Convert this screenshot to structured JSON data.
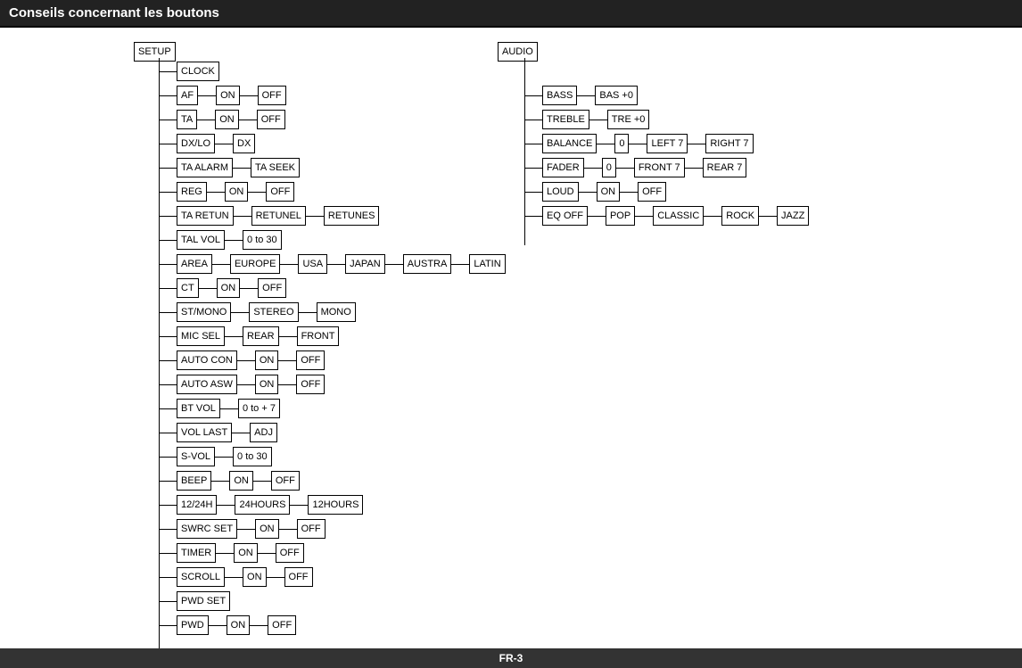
{
  "header": {
    "title": "Conseils concernant les boutons"
  },
  "footer": {
    "label": "FR-3"
  },
  "setup": {
    "label": "SETUP"
  },
  "audio": {
    "label": "AUDIO"
  },
  "left_rows": [
    {
      "id": "clock",
      "main": "CLOCK",
      "children": []
    },
    {
      "id": "af",
      "main": "AF",
      "children": [
        "ON",
        "OFF"
      ]
    },
    {
      "id": "ta",
      "main": "TA",
      "children": [
        "ON",
        "OFF"
      ]
    },
    {
      "id": "dxlo",
      "main": "DX/LO",
      "children": [
        "DX"
      ]
    },
    {
      "id": "ta-alarm",
      "main": "TA ALARM",
      "children": [
        "TA SEEK"
      ]
    },
    {
      "id": "reg",
      "main": "REG",
      "children": [
        "ON",
        "OFF"
      ]
    },
    {
      "id": "ta-retun",
      "main": "TA RETUN",
      "children": [
        "RETUNEL",
        "RETUNES"
      ]
    },
    {
      "id": "tal-vol",
      "main": "TAL VOL",
      "children": [
        "0 to 30"
      ]
    },
    {
      "id": "area",
      "main": "AREA",
      "children": [
        "EUROPE",
        "USA",
        "JAPAN",
        "AUSTRA",
        "LATIN"
      ]
    },
    {
      "id": "ct",
      "main": "CT",
      "children": [
        "ON",
        "OFF"
      ]
    },
    {
      "id": "stmono",
      "main": "ST/MONO",
      "children": [
        "STEREO",
        "MONO"
      ]
    },
    {
      "id": "mic-sel",
      "main": "MIC SEL",
      "children": [
        "REAR",
        "FRONT"
      ]
    },
    {
      "id": "auto-con",
      "main": "AUTO CON",
      "children": [
        "ON",
        "OFF"
      ]
    },
    {
      "id": "auto-asw",
      "main": "AUTO ASW",
      "children": [
        "ON",
        "OFF"
      ]
    },
    {
      "id": "bt-vol",
      "main": "BT VOL",
      "children": [
        "0 to + 7"
      ]
    },
    {
      "id": "vol-last",
      "main": "VOL LAST",
      "children": [
        "ADJ"
      ]
    },
    {
      "id": "s-vol",
      "main": "S-VOL",
      "children": [
        "0 to 30"
      ]
    },
    {
      "id": "beep",
      "main": "BEEP",
      "children": [
        "ON",
        "OFF"
      ]
    },
    {
      "id": "1224h",
      "main": "12/24H",
      "children": [
        "24HOURS",
        "12HOURS"
      ]
    },
    {
      "id": "swrc-set",
      "main": "SWRC SET",
      "children": [
        "ON",
        "OFF"
      ]
    },
    {
      "id": "timer",
      "main": "TIMER",
      "children": [
        "ON",
        "OFF"
      ]
    },
    {
      "id": "scroll",
      "main": "SCROLL",
      "children": [
        "ON",
        "OFF"
      ]
    },
    {
      "id": "pwd-set",
      "main": "PWD SET",
      "children": []
    },
    {
      "id": "pwd",
      "main": "PWD",
      "children": [
        "ON",
        "OFF"
      ]
    }
  ],
  "right_rows": [
    {
      "id": "bass",
      "main": "BASS",
      "children": [
        "BAS +0"
      ]
    },
    {
      "id": "treble",
      "main": "TREBLE",
      "children": [
        "TRE +0"
      ]
    },
    {
      "id": "balance",
      "main": "BALANCE",
      "children": [
        "0",
        "LEFT 7",
        "RIGHT 7"
      ]
    },
    {
      "id": "fader",
      "main": "FADER",
      "children": [
        "0",
        "FRONT 7",
        "REAR 7"
      ]
    },
    {
      "id": "loud",
      "main": "LOUD",
      "children": [
        "ON",
        "OFF"
      ]
    },
    {
      "id": "eq-off",
      "main": "EQ OFF",
      "children": [
        "POP",
        "CLASSIC",
        "ROCK",
        "JAZZ"
      ]
    }
  ]
}
